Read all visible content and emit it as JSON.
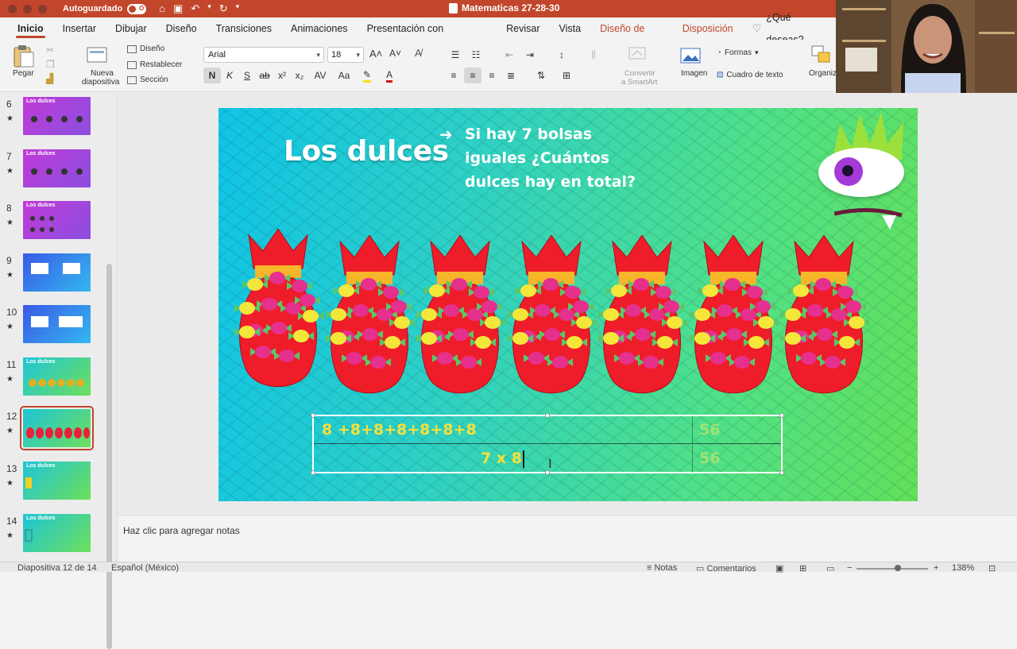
{
  "titlebar": {
    "autosave_label": "Autoguardado",
    "autosave_state": "O",
    "doc_title": "Matematicas 27-28-30"
  },
  "tabs": [
    {
      "label": "Inicio"
    },
    {
      "label": "Insertar"
    },
    {
      "label": "Dibujar"
    },
    {
      "label": "Diseño"
    },
    {
      "label": "Transiciones"
    },
    {
      "label": "Animaciones"
    },
    {
      "label": "Presentación con diapositivas"
    },
    {
      "label": "Revisar"
    },
    {
      "label": "Vista"
    },
    {
      "label": "Diseño de tabla"
    },
    {
      "label": "Disposición"
    },
    {
      "label": "¿Qué deseas?"
    }
  ],
  "ribbon": {
    "paste": "Pegar",
    "new_slide_1": "Nueva",
    "new_slide_2": "diapositiva",
    "layout": "Diseño",
    "reset": "Restablecer",
    "section": "Sección",
    "font": "Arial",
    "size": "18",
    "bold": "N",
    "italic": "K",
    "underline": "S",
    "strike": "ab",
    "superscript": "x²",
    "subscript": "x₂",
    "spacing": "AV",
    "aa": "Aa",
    "smartart_1": "Convertir",
    "smartart_2": "a SmartArt",
    "image": "Imagen",
    "shapes": "Formas",
    "textbox": "Cuadro de texto",
    "organize": "Organiz"
  },
  "thumbnails": [
    {
      "num": "6",
      "title": "Los dulces",
      "theme": "purple"
    },
    {
      "num": "7",
      "title": "Los dulces",
      "theme": "purple"
    },
    {
      "num": "8",
      "title": "Los dulces",
      "theme": "purple"
    },
    {
      "num": "9",
      "title": "",
      "theme": "blue"
    },
    {
      "num": "10",
      "title": "",
      "theme": "blue"
    },
    {
      "num": "11",
      "title": "Los dulces",
      "theme": "green"
    },
    {
      "num": "12",
      "title": "",
      "theme": "green",
      "selected": true
    },
    {
      "num": "13",
      "title": "Los dulces",
      "theme": "green"
    },
    {
      "num": "14",
      "title": "Los dulces",
      "theme": "green"
    }
  ],
  "slide": {
    "title": "Los dulces",
    "question": "Si hay 7 bolsas iguales ¿Cuántos dulces hay en total?",
    "bag_count": 7,
    "table": {
      "row1": {
        "expr": "8 +8+8+8+8+8+8",
        "result": "56"
      },
      "row2": {
        "expr": "7 x 8",
        "result": "56"
      }
    }
  },
  "notes_placeholder": "Haz clic para agregar notas",
  "status": {
    "slide_info": "Diapositiva 12 de 14",
    "language": "Español (México)",
    "notes": "Notas",
    "comments": "Comentarios",
    "zoom": "138%"
  },
  "colors": {
    "accent": "#c1462b",
    "table_text": "#f6e03a"
  }
}
